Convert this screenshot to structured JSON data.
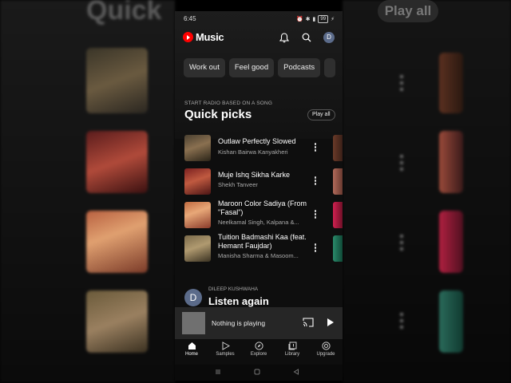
{
  "background": {
    "left_heading": "Quick",
    "right_pill": "Play all"
  },
  "status_bar": {
    "time": "6:45",
    "battery": "99"
  },
  "top_bar": {
    "app_name": "Music",
    "avatar_letter": "D"
  },
  "chips": [
    "Work out",
    "Feel good",
    "Podcasts"
  ],
  "quick_picks": {
    "subtitle": "START RADIO BASED ON A SONG",
    "title": "Quick picks",
    "play_all": "Play all",
    "songs": [
      {
        "title": "Outlaw Perfectly Slowed",
        "artist": "Kishan Bairwa Kanyakheri"
      },
      {
        "title": "Muje Ishq Sikha Karke",
        "artist": "Shekh Tanveer"
      },
      {
        "title": "Maroon Color Sadiya (From \"Fasal\")",
        "artist": "Neelkamal Singh, Kalpana &..."
      },
      {
        "title": "Tuition Badmashi Kaa (feat. Hemant Faujdar)",
        "artist": "Manisha Sharma & Masoom..."
      }
    ]
  },
  "listen_again": {
    "avatar_letter": "D",
    "subtitle": "DILEEP KUSHWAHA",
    "title": "Listen again"
  },
  "mini_player": {
    "text": "Nothing is playing"
  },
  "bottom_nav": {
    "items": [
      "Home",
      "Samples",
      "Explore",
      "Library",
      "Upgrade"
    ]
  },
  "colors": {
    "brand_red": "#ff0000",
    "surface": "#0e0e0e",
    "chip": "#2f2f2f",
    "mini_player": "#262626"
  }
}
